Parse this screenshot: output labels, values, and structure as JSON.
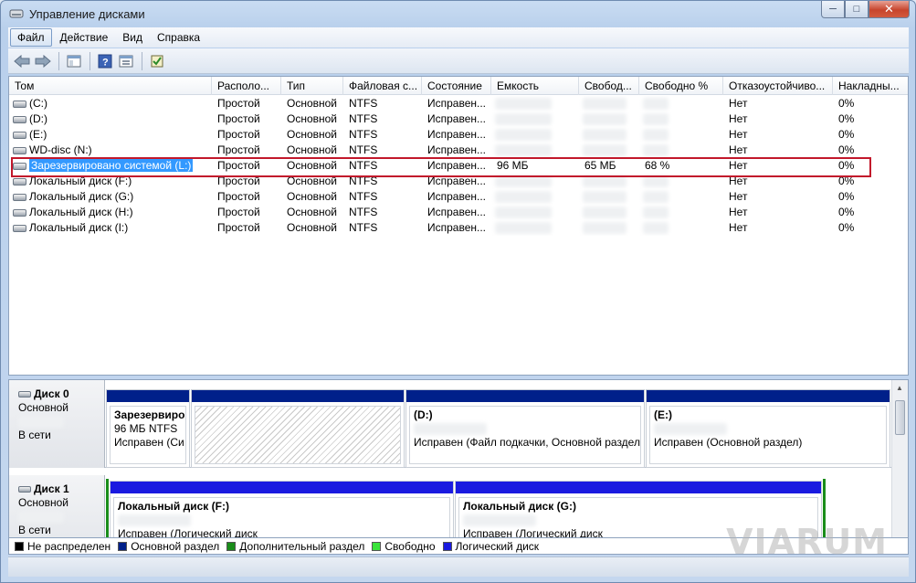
{
  "window": {
    "title": "Управление дисками"
  },
  "menu": [
    "Файл",
    "Действие",
    "Вид",
    "Справка"
  ],
  "columns": [
    "Том",
    "Располо...",
    "Тип",
    "Файловая с...",
    "Состояние",
    "Емкость",
    "Свобод...",
    "Свободно %",
    "Отказоустойчиво...",
    "Накладны..."
  ],
  "volumes": [
    {
      "name": "(C:)",
      "layout": "Простой",
      "type": "Основной",
      "fs": "NTFS",
      "status": "Исправен...",
      "capacity": "",
      "free": "",
      "free_pct": "",
      "fault": "Нет",
      "overhead": "0%"
    },
    {
      "name": "(D:)",
      "layout": "Простой",
      "type": "Основной",
      "fs": "NTFS",
      "status": "Исправен...",
      "capacity": "",
      "free": "",
      "free_pct": "",
      "fault": "Нет",
      "overhead": "0%"
    },
    {
      "name": "(E:)",
      "layout": "Простой",
      "type": "Основной",
      "fs": "NTFS",
      "status": "Исправен...",
      "capacity": "",
      "free": "",
      "free_pct": "",
      "fault": "Нет",
      "overhead": "0%"
    },
    {
      "name": "WD-disc (N:)",
      "layout": "Простой",
      "type": "Основной",
      "fs": "NTFS",
      "status": "Исправен...",
      "capacity": "",
      "free": "",
      "free_pct": "",
      "fault": "Нет",
      "overhead": "0%"
    },
    {
      "name": "Зарезервировано системой (L:)",
      "layout": "Простой",
      "type": "Основной",
      "fs": "NTFS",
      "status": "Исправен...",
      "capacity": "96 МБ",
      "free": "65 МБ",
      "free_pct": "68 %",
      "fault": "Нет",
      "overhead": "0%"
    },
    {
      "name": "Локальный диск (F:)",
      "layout": "Простой",
      "type": "Основной",
      "fs": "NTFS",
      "status": "Исправен...",
      "capacity": "",
      "free": "",
      "free_pct": "",
      "fault": "Нет",
      "overhead": "0%"
    },
    {
      "name": "Локальный диск (G:)",
      "layout": "Простой",
      "type": "Основной",
      "fs": "NTFS",
      "status": "Исправен...",
      "capacity": "",
      "free": "",
      "free_pct": "",
      "fault": "Нет",
      "overhead": "0%"
    },
    {
      "name": "Локальный диск (H:)",
      "layout": "Простой",
      "type": "Основной",
      "fs": "NTFS",
      "status": "Исправен...",
      "capacity": "",
      "free": "",
      "free_pct": "",
      "fault": "Нет",
      "overhead": "0%"
    },
    {
      "name": "Локальный диск (I:)",
      "layout": "Простой",
      "type": "Основной",
      "fs": "NTFS",
      "status": "Исправен...",
      "capacity": "",
      "free": "",
      "free_pct": "",
      "fault": "Нет",
      "overhead": "0%"
    }
  ],
  "disk0": {
    "title": "Диск 0",
    "kind": "Основной",
    "state": "В сети",
    "parts": {
      "reserved": {
        "name": "Зарезервиро",
        "size": "96 МБ NTFS",
        "status": "Исправен (Си"
      },
      "d": {
        "name": "(D:)",
        "status": "Исправен (Файл подкачки, Основной раздел"
      },
      "e": {
        "name": "(E:)",
        "status": "Исправен (Основной раздел)"
      }
    }
  },
  "disk1": {
    "title": "Диск 1",
    "kind": "Основной",
    "state": "В сети",
    "parts": {
      "f": {
        "name": "Локальный диск  (F:)",
        "status": "Исправен (Логический диск"
      },
      "g": {
        "name": "Локальный диск  (G:)",
        "status": "Исправен (Логический диск"
      }
    }
  },
  "legend": [
    {
      "label": "Не распределен",
      "color": "#000000"
    },
    {
      "label": "Основной раздел",
      "color": "#00208a"
    },
    {
      "label": "Дополнительный раздел",
      "color": "#1a8d1a"
    },
    {
      "label": "Свободно",
      "color": "#39e339"
    },
    {
      "label": "Логический диск",
      "color": "#1a1ae0"
    }
  ],
  "watermark": "VIARUM"
}
